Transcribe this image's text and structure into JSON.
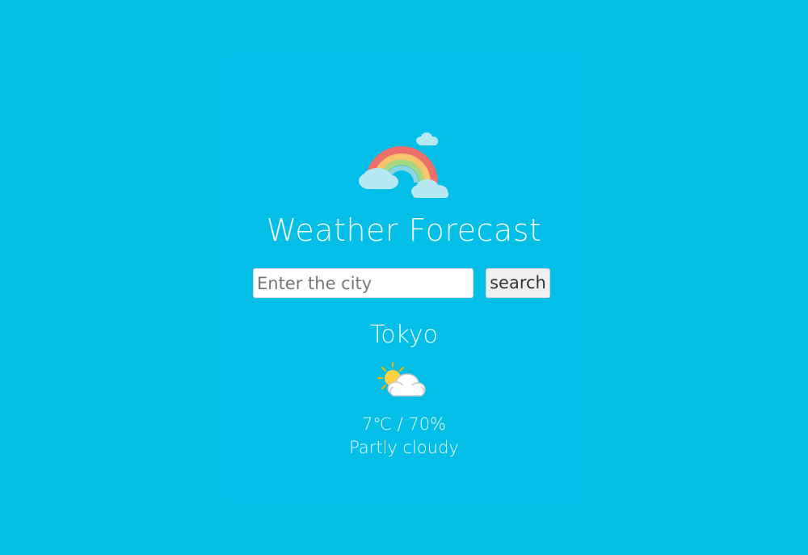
{
  "app": {
    "title": "Weather Forecast",
    "hero_icon": "rainbow-cloud-icon"
  },
  "search": {
    "placeholder": "Enter the city",
    "value": "",
    "button_label": "search"
  },
  "weather": {
    "city": "Tokyo",
    "icon": "partly-cloudy-icon",
    "temperature": "7℃",
    "humidity": "70%",
    "summary": "7℃ / 70%",
    "condition": "Partly cloudy"
  },
  "colors": {
    "background": "#03bfe6",
    "text": "#f2fcff"
  }
}
